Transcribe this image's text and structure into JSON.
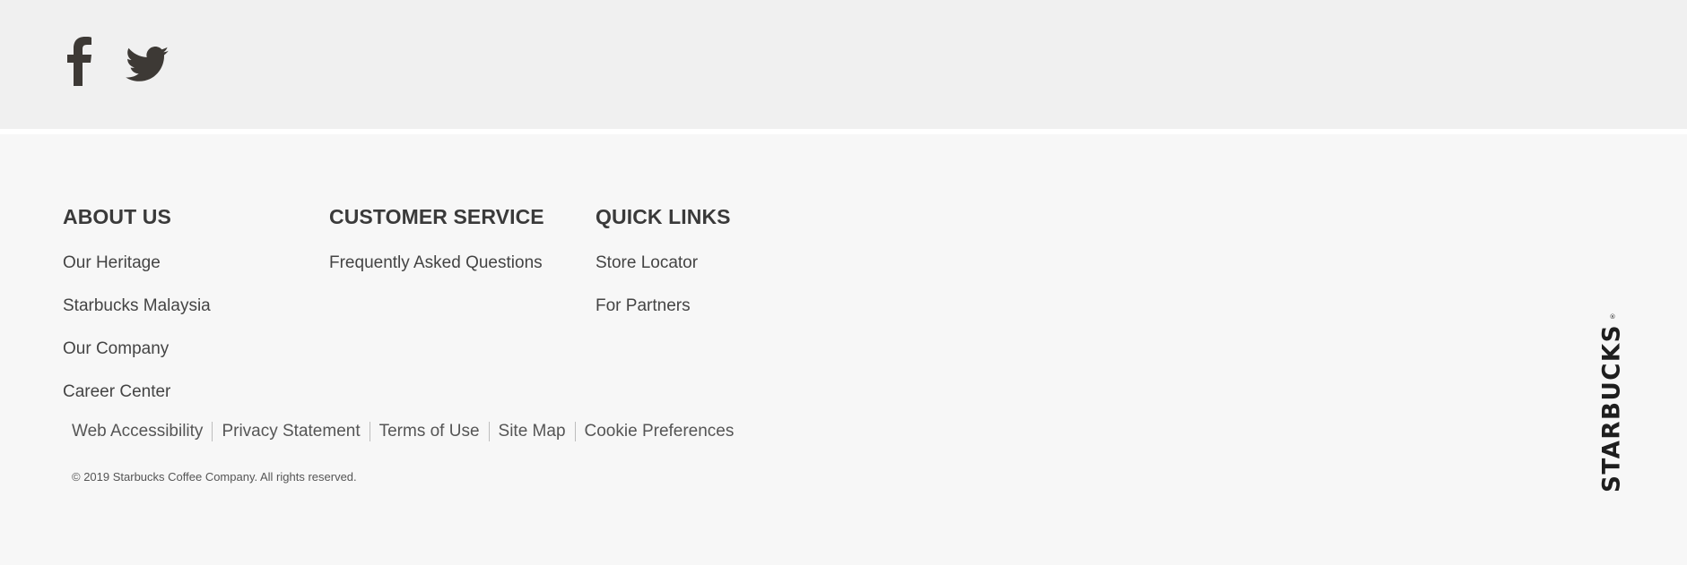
{
  "social": {
    "facebook_icon": "facebook-icon",
    "twitter_icon": "twitter-icon",
    "icon_color": "#3d3935"
  },
  "footer": {
    "columns": [
      {
        "heading": "ABOUT US",
        "links": [
          "Our Heritage",
          "Starbucks Malaysia",
          "Our Company",
          "Career Center"
        ]
      },
      {
        "heading": "CUSTOMER SERVICE",
        "links": [
          "Frequently Asked Questions"
        ]
      },
      {
        "heading": "QUICK LINKS",
        "links": [
          "Store Locator",
          "For Partners"
        ]
      }
    ],
    "legal_links": [
      "Web Accessibility",
      "Privacy Statement",
      "Terms of Use",
      "Site Map",
      "Cookie Preferences"
    ],
    "copyright": "© 2019 Starbucks Coffee Company. All rights reserved.",
    "brand_wordmark": "STARBUCKS",
    "brand_mark": "®"
  },
  "colors": {
    "social_bar_bg": "#f0f0f0",
    "footer_bg": "#f7f7f7",
    "heading_text": "#3a3a3a",
    "link_text": "#444444",
    "logo_color": "#1e1e1e"
  }
}
